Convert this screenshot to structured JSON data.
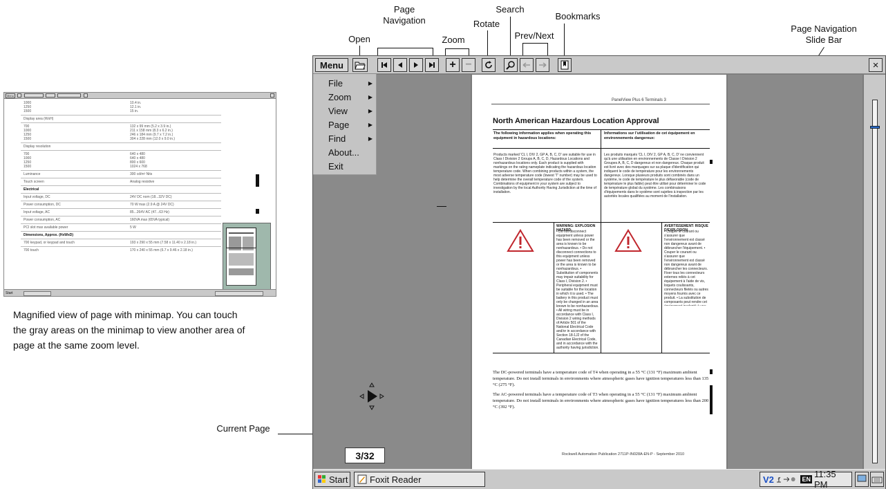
{
  "callouts": {
    "page_navigation": "Page\nNavigation",
    "search": "Search",
    "bookmarks": "Bookmarks",
    "rotate": "Rotate",
    "prev_next": "Prev/Next",
    "open": "Open",
    "zoom": "Zoom",
    "page_navigation_slide_bar": "Page Navigation\nSlide Bar",
    "current_page": "Current Page"
  },
  "caption": "Magnified view of page with minimap. You can touch the gray areas on the minimap to view another area of page at the same zoom level.",
  "toolbar": {
    "menu_label": "Menu",
    "zoom_in": "+",
    "zoom_out": "−",
    "close": "×"
  },
  "menu": {
    "items": [
      {
        "label": "File",
        "submenu": true
      },
      {
        "label": "Zoom",
        "submenu": true
      },
      {
        "label": "View",
        "submenu": true
      },
      {
        "label": "Page",
        "submenu": true
      },
      {
        "label": "Find",
        "submenu": true
      },
      {
        "label": "About...",
        "submenu": false
      },
      {
        "label": "Exit",
        "submenu": false
      }
    ]
  },
  "document": {
    "header": "PanelView Plus 6 Terminals   3",
    "title": "North American Hazardous Location Approval",
    "col_left_heading": "The following information applies when operating this equipment in hazardous locations:",
    "col_right_heading": "Informations sur l'utilisation de cet équipement en environnements dangereux:",
    "col_left_body": "Products marked 'CL I, DIV 2, GP A, B, C, D' are suitable for use in Class I Division 2 Groups A, B, C, D, Hazardous Locations and nonhazardous locations only. Each product is supplied with markings on the rating nameplate indicating the hazardous location temperature code. When combining products within a system, the most adverse temperature code (lowest 'T' number) may be used to help determine the overall temperature code of the system. Combinations of equipment in your system are subject to investigation by the local Authority Having Jurisdiction at the time of installation.",
    "col_right_body": "Les produits marqués 'CL I, DIV 2, GP A, B, C, D' ne conviennent qu'à une utilisation en environnements de Classe I Division 2 Groupes A, B, C, D dangereux et non dangereux. Chaque produit est livré avec des marquages sur sa plaque d'identification qui indiquent le code de température pour les environnements dangereux. Lorsque plusieurs produits sont combinés dans un système, le code de température le plus défavorable (code de température le plus faible) peut être utilisé pour déterminer le code de température global du système. Les combinaisons d'équipements dans le système sont sujettes à inspection par les autorités locales qualifiées au moment de l'installation.",
    "warning_left_title": "WARNING: EXPLOSION HAZARD",
    "warning_right_title": "AVERTISSEMENT: RISQUE D'EXPLOSION",
    "warning_left_body": "• Do not disconnect equipment unless power has been removed or the area is known to be nonhazardous. • Do not disconnect connections to this equipment unless power has been removed or the area is known to be nonhazardous. • Substitution of components may impair suitability for Class I, Division 2. • Peripheral equipment must be suitable for the location in which it is used. • The battery in this product must only be changed in an area known to be nonhazardous. • All wiring must be in accordance with Class I, Division 2 wiring methods of Article 501 of the National Electrical Code and/or in accordance with Section 18-1J2 of the Canadian Electrical Code, and in accordance with the authority having jurisdiction.",
    "warning_right_body": "• Couper le courant ou s'assurer que l'environnement est classé non dangereux avant de débrancher l'équipement. • Couper le courant ou s'assurer que l'environnement est classé non dangereux avant de débrancher les connecteurs. Fixer tous les connecteurs externes reliés à cet équipement à l'aide de vis, loquets coulissants, connecteurs filetés ou autres moyens fournis avec ce produit. • La substitution de composants peut rendre cet équipement inadapté à une utilisation en environnement de Classe I, Division 2. • S'assurer que l'environnement est classé non dangereux avant de changer les piles.",
    "para1": "The DC-powered terminals have a temperature code of T4 when operating in a 55 °C (131 °F) maximum ambient temperature. Do not install terminals in environments where atmospheric gases have ignition temperatures less than 135 °C (275 °F).",
    "para2": "The AC-powered terminals have a temperature code of T3 when operating in a 55 °C (131 °F) maximum ambient temperature. Do not install terminals in environments where atmospheric gases have ignition temperatures less than 200 °C (392 °F).",
    "footer": "Rockwell Automation Publication 2711P-IN028A-EN-P - September 2010"
  },
  "current_page": "3/32",
  "taskbar": {
    "start_label": "Start",
    "app_label": "Foxit Reader",
    "tray_text": "V2",
    "lang": "EN",
    "time": "11:35 PM"
  },
  "thumbnail": {
    "menu_label": "Menu",
    "start_label": "Start",
    "rows": [
      {
        "label": "1000",
        "value": "10.4 in."
      },
      {
        "label": "1250",
        "value": "12.1 in."
      },
      {
        "label": "1500",
        "value": "15 in."
      },
      {
        "label": "Display area (WxH)",
        "value": ""
      },
      {
        "label": "700",
        "value": "132 x 99 mm (5.2 x 3.9 in.)"
      },
      {
        "label": "1000",
        "value": "211 x 158 mm (8.3 x 6.2 in.)"
      },
      {
        "label": "1250",
        "value": "246 x 184 mm (9.7 x 7.2 in.)"
      },
      {
        "label": "1500",
        "value": "304 x 228 mm (12.0 x 9.0 in.)"
      },
      {
        "label": "Display resolution",
        "value": ""
      },
      {
        "label": "700",
        "value": "640 x 480"
      },
      {
        "label": "1000",
        "value": "640 x 480"
      },
      {
        "label": "1250",
        "value": "800 x 600"
      },
      {
        "label": "1500",
        "value": "1024 x 768"
      },
      {
        "label": "Luminance",
        "value": "300 cd/m² Nits"
      },
      {
        "label": "Touch screen",
        "value": "Analog resistive"
      },
      {
        "label": "Electrical",
        "value": ""
      },
      {
        "label": "Input voltage, DC",
        "value": "24V DC nom (18...32V DC)"
      },
      {
        "label": "Power consumption, DC",
        "value": "70 W max (2.9 A @ 24V DC)"
      },
      {
        "label": "Input voltage, AC",
        "value": "85...264V AC (47...63 Hz)"
      },
      {
        "label": "Power consumption, AC",
        "value": "160VA max (65VA typical)"
      },
      {
        "label": "PCI slot max available power",
        "value": "5 W"
      },
      {
        "label": "Dimensions, Approx. (HxWxD)",
        "value": ""
      },
      {
        "label": "700 keypad, or keypad and touch",
        "value": "193 x 290 x 55 mm (7.58 x 11.40 x 2.18 in.)"
      },
      {
        "label": "700 touch",
        "value": "170 x 240 x 55 mm (6.7 x 9.46 x 2.18 in.)"
      }
    ]
  },
  "colors": {
    "window_bg": "#7b7b7b",
    "toolbar_bg": "#c9c9c9",
    "page_bg": "#ffffff",
    "accent": "#2f6fd0"
  }
}
